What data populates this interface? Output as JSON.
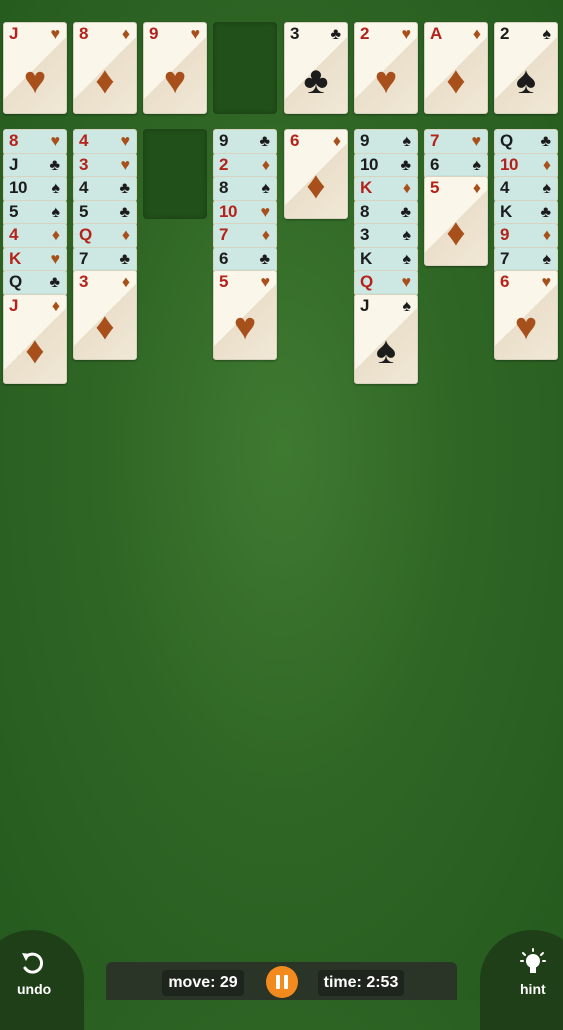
{
  "foundations_and_cells": [
    {
      "rank": "J",
      "suit": "heart"
    },
    {
      "rank": "8",
      "suit": "diamond"
    },
    {
      "rank": "9",
      "suit": "heart"
    },
    null,
    {
      "rank": "3",
      "suit": "club"
    },
    {
      "rank": "2",
      "suit": "heart"
    },
    {
      "rank": "A",
      "suit": "diamond"
    },
    {
      "rank": "2",
      "suit": "spade"
    }
  ],
  "tableau": [
    [
      {
        "rank": "8",
        "suit": "heart"
      },
      {
        "rank": "J",
        "suit": "club"
      },
      {
        "rank": "10",
        "suit": "spade"
      },
      {
        "rank": "5",
        "suit": "spade"
      },
      {
        "rank": "4",
        "suit": "diamond"
      },
      {
        "rank": "K",
        "suit": "heart"
      },
      {
        "rank": "Q",
        "suit": "club"
      },
      {
        "rank": "J",
        "suit": "diamond"
      }
    ],
    [
      {
        "rank": "4",
        "suit": "heart"
      },
      {
        "rank": "3",
        "suit": "heart"
      },
      {
        "rank": "4",
        "suit": "club"
      },
      {
        "rank": "5",
        "suit": "club"
      },
      {
        "rank": "Q",
        "suit": "diamond"
      },
      {
        "rank": "7",
        "suit": "club"
      },
      {
        "rank": "3",
        "suit": "diamond"
      }
    ],
    [],
    [
      {
        "rank": "9",
        "suit": "club"
      },
      {
        "rank": "2",
        "suit": "diamond"
      },
      {
        "rank": "8",
        "suit": "spade"
      },
      {
        "rank": "10",
        "suit": "heart"
      },
      {
        "rank": "7",
        "suit": "diamond"
      },
      {
        "rank": "6",
        "suit": "club"
      },
      {
        "rank": "5",
        "suit": "heart"
      }
    ],
    [
      {
        "rank": "6",
        "suit": "diamond"
      }
    ],
    [
      {
        "rank": "9",
        "suit": "spade"
      },
      {
        "rank": "10",
        "suit": "club"
      },
      {
        "rank": "K",
        "suit": "diamond"
      },
      {
        "rank": "8",
        "suit": "club"
      },
      {
        "rank": "3",
        "suit": "spade"
      },
      {
        "rank": "K",
        "suit": "spade"
      },
      {
        "rank": "Q",
        "suit": "heart"
      },
      {
        "rank": "J",
        "suit": "spade"
      }
    ],
    [
      {
        "rank": "7",
        "suit": "heart"
      },
      {
        "rank": "6",
        "suit": "spade"
      },
      {
        "rank": "5",
        "suit": "diamond"
      }
    ],
    [
      {
        "rank": "Q",
        "suit": "club"
      },
      {
        "rank": "10",
        "suit": "diamond"
      },
      {
        "rank": "4",
        "suit": "spade"
      },
      {
        "rank": "K",
        "suit": "club"
      },
      {
        "rank": "9",
        "suit": "diamond"
      },
      {
        "rank": "7",
        "suit": "spade"
      },
      {
        "rank": "6",
        "suit": "heart"
      }
    ]
  ],
  "colors": {
    "felt": "#2f6625",
    "red_rank": "#b4231b",
    "red_suit": "#a8501c",
    "black": "#1c1c1c",
    "covered_card": "#cde8e3",
    "pause": "#f28a1e"
  },
  "controls": {
    "undo_label": "undo",
    "hint_label": "hint",
    "move_text": "move: 29",
    "time_text": "time: 2:53",
    "undo_icon": "undo-arrow-icon",
    "hint_icon": "lightbulb-icon",
    "pause_icon": "pause-icon"
  }
}
